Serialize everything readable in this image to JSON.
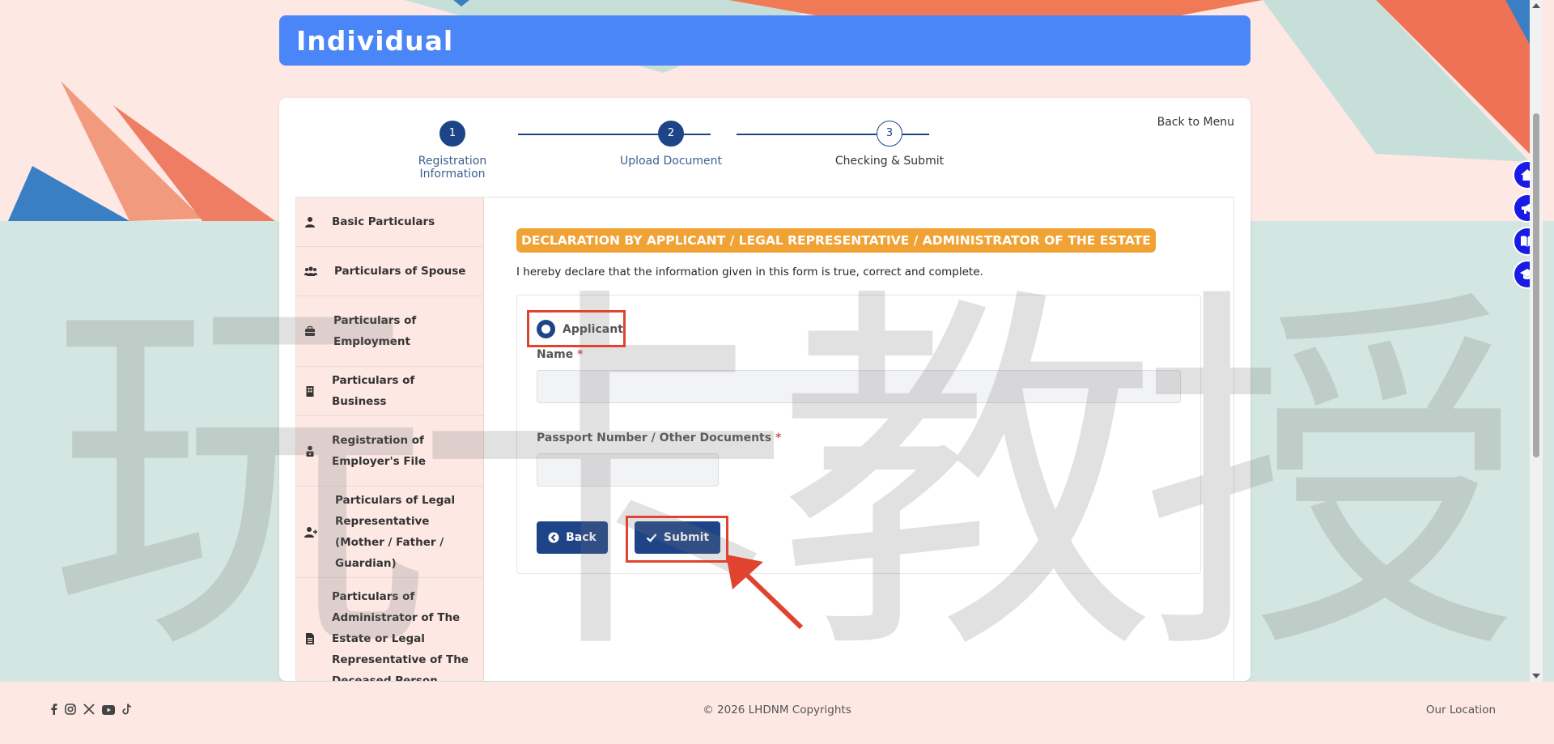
{
  "header": {
    "title": "Individual"
  },
  "card": {
    "back_to_menu": "Back to Menu"
  },
  "stepper": {
    "steps": [
      {
        "number": "1",
        "label": "Registration Information",
        "state": "done"
      },
      {
        "number": "2",
        "label": "Upload Document",
        "state": "done"
      },
      {
        "number": "3",
        "label": "Checking & Submit",
        "state": "current"
      }
    ]
  },
  "sidebar": {
    "items": [
      {
        "label": "Basic Particulars",
        "icon": "user-icon"
      },
      {
        "label": "Particulars of Spouse",
        "icon": "users-icon"
      },
      {
        "label": "Particulars of Employment",
        "icon": "briefcase-icon"
      },
      {
        "label": "Particulars of Business",
        "icon": "building-icon"
      },
      {
        "label": "Registration of Employer's File",
        "icon": "user-lock-icon"
      },
      {
        "label": "Particulars of Legal Representative (Mother / Father / Guardian)",
        "icon": "user-plus-icon"
      },
      {
        "label": "Particulars of Administrator of The Estate or Legal Representative of The Deceased Person",
        "icon": "file-icon"
      }
    ]
  },
  "declaration": {
    "title": "DECLARATION BY APPLICANT / LEGAL REPRESENTATIVE / ADMINISTRATOR OF THE ESTATE",
    "text": "I hereby declare that the information given in this form is true, correct and complete."
  },
  "form": {
    "radio_label": "Applicant",
    "name_label": "Name",
    "name_value": "",
    "passport_label": "Passport Number / Other Documents",
    "passport_value": "",
    "required_mark": "*",
    "back_label": "Back",
    "submit_label": "Submit"
  },
  "watermark": "玩卡教授",
  "footer": {
    "copyright": "© 2026 LHDNM Copyrights",
    "our_location": "Our Location",
    "social": [
      "facebook-icon",
      "instagram-icon",
      "x-icon",
      "youtube-icon",
      "tiktok-icon"
    ]
  },
  "colors": {
    "primary": "#1e4488",
    "banner": "#4a86f7",
    "accent": "#f0a334",
    "annotation": "#e0442f",
    "float_icon": "#1a1ae6"
  }
}
